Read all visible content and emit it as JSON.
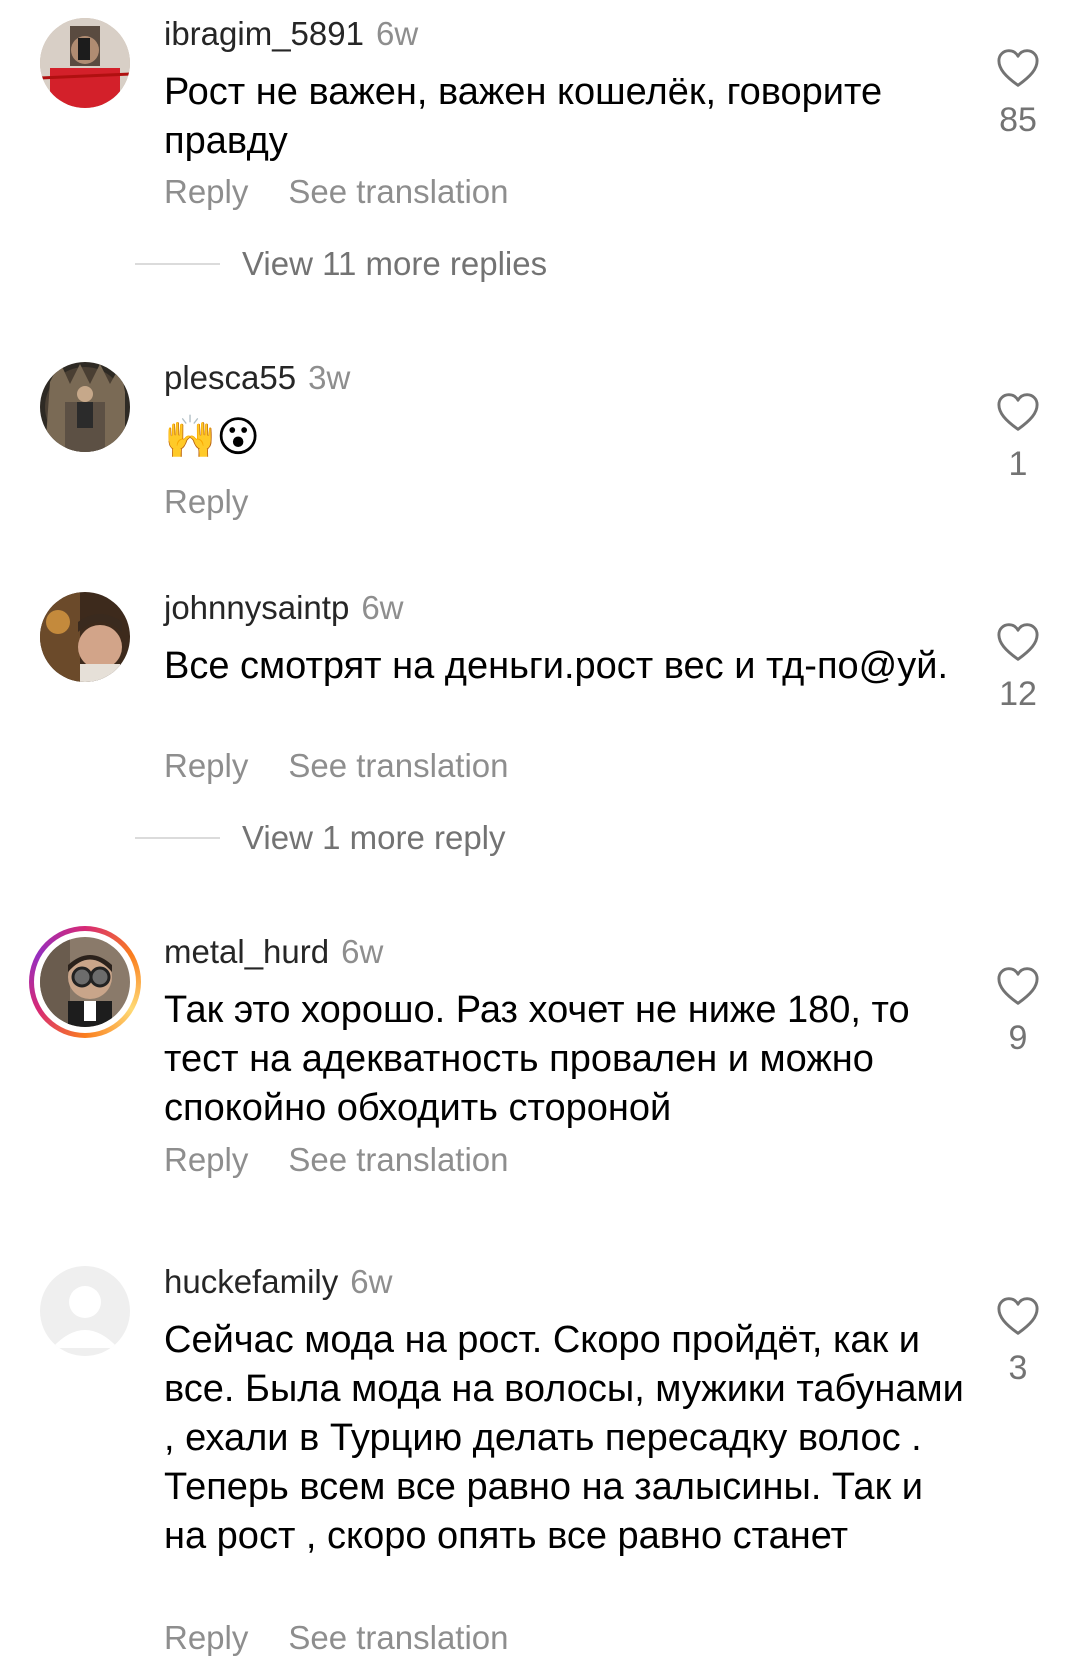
{
  "comments": [
    {
      "username": "ibragim_5891",
      "time": "6w",
      "text": "Рост не важен, важен кошелёк, говорите правду",
      "likes": "85",
      "reply_label": "Reply",
      "translate_label": "See translation",
      "more_replies": "View 11 more replies"
    },
    {
      "username": "plesca55",
      "time": "3w",
      "text": "🙌😮",
      "likes": "1",
      "reply_label": "Reply"
    },
    {
      "username": "johnnysaintp",
      "time": "6w",
      "text": "Все смотрят на деньги.рост вес и тд-по@уй.",
      "likes": "12",
      "reply_label": "Reply",
      "translate_label": "See translation",
      "more_replies": "View 1 more reply"
    },
    {
      "username": "metal_hurd",
      "time": "6w",
      "text": "Так это хорошо. Раз хочет не ниже 180, то тест на адекватность провален и можно спокойно обходить стороной",
      "likes": "9",
      "reply_label": "Reply",
      "translate_label": "See translation"
    },
    {
      "username": "huckefamily",
      "time": "6w",
      "text": "Сейчас мода на рост. Скоро пройдёт, как и все. Была мода на волосы, мужики табунами , ехали в Турцию делать пересадку волос . Теперь всем все равно на залысины. Так и на рост , скоро опять все равно станет",
      "likes": "3",
      "reply_label": "Reply",
      "translate_label": "See translation"
    }
  ],
  "icons": {
    "like": "heart-outline-icon",
    "default_avatar": "person-silhouette-icon"
  },
  "colors": {
    "secondary_text": "#8e8e8e",
    "story_ring_start": "#d62976",
    "story_ring_end": "#feda75"
  }
}
